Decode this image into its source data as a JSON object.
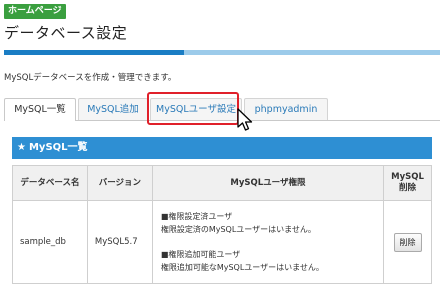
{
  "header": {
    "badge": "ホームページ",
    "title": "データベース設定",
    "description": "MySQLデータベースを作成・管理できます。"
  },
  "tabs": [
    {
      "label": "MySQL一覧",
      "active": true
    },
    {
      "label": "MySQL追加",
      "active": false
    },
    {
      "label": "MySQLユーザ設定",
      "active": false
    },
    {
      "label": "phpmyadmin",
      "active": false
    }
  ],
  "panel": {
    "icon": "star-icon",
    "title": "MySQL一覧"
  },
  "table": {
    "headers": {
      "db_name": "データベース名",
      "version": "バージョン",
      "user_perm": "MySQLユーザ権限",
      "delete_line1": "MySQL",
      "delete_line2": "削除"
    },
    "rows": [
      {
        "db_name": "sample_db",
        "version": "MySQL5.7",
        "set_title": "■権限設定済ユーザ",
        "set_value": "権限設定済のMySQLユーザーはいません。",
        "add_title": "■権限追加可能ユーザ",
        "add_value": "権限追加可能なMySQLユーザーはいません。",
        "delete_label": "削除"
      }
    ]
  },
  "colors": {
    "accent": "#2e8fd3",
    "badge": "#3a9f3f",
    "highlight": "#e0202a"
  }
}
